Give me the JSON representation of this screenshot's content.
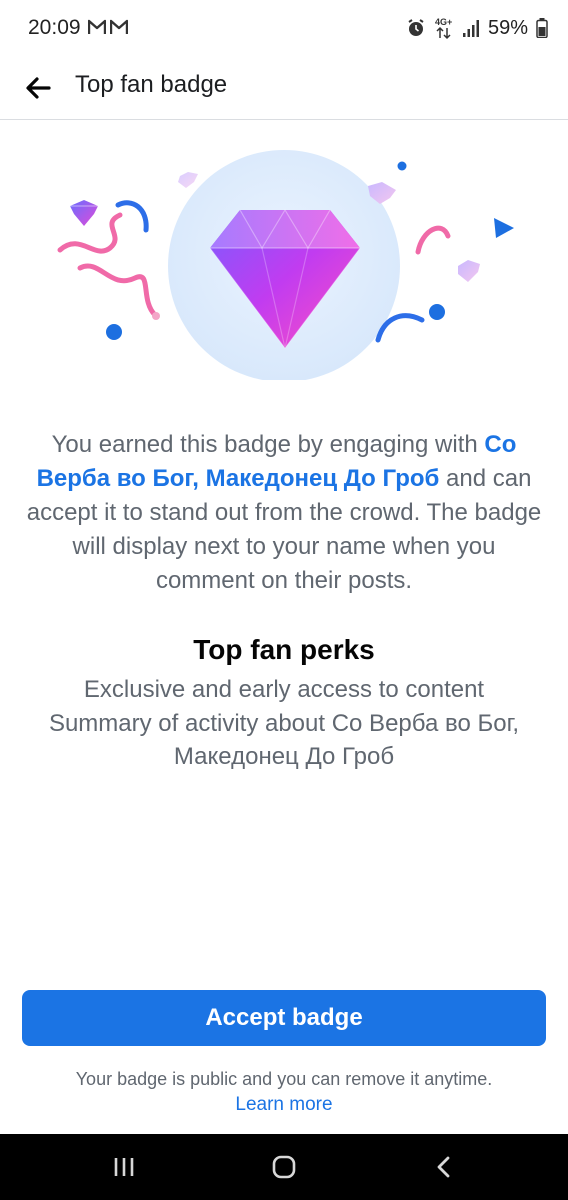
{
  "status_bar": {
    "time": "20:09",
    "battery": "59%",
    "network": "4G+",
    "icons": [
      "gmail-icon",
      "gmail-icon",
      "alarm-icon",
      "network-4g-icon",
      "signal-icon",
      "battery-icon"
    ]
  },
  "header": {
    "title": "Top fan badge",
    "back_icon": "arrow-left-icon"
  },
  "illustration": {
    "icon": "diamond-badge-icon"
  },
  "description": {
    "part1": "You earned this badge by engaging with ",
    "page_name": "Со Верба во Бог, Македонец До Гроб",
    "part2": " and can accept it to stand out from the crowd. The badge will display next to your name when you comment on their posts."
  },
  "perks": {
    "title": "Top fan perks",
    "items": [
      "Exclusive and early access to content",
      "Summary of activity about Со Верба во Бог, Македонец До Гроб"
    ]
  },
  "actions": {
    "accept_label": "Accept badge",
    "note": "Your badge is public and you can remove it anytime.",
    "learn_more": "Learn more"
  },
  "nav_bar": {
    "icons": [
      "recent-apps-icon",
      "home-icon",
      "back-icon"
    ]
  },
  "colors": {
    "accent": "#1b74e4",
    "text_secondary": "#606770",
    "text_primary": "#050505"
  }
}
